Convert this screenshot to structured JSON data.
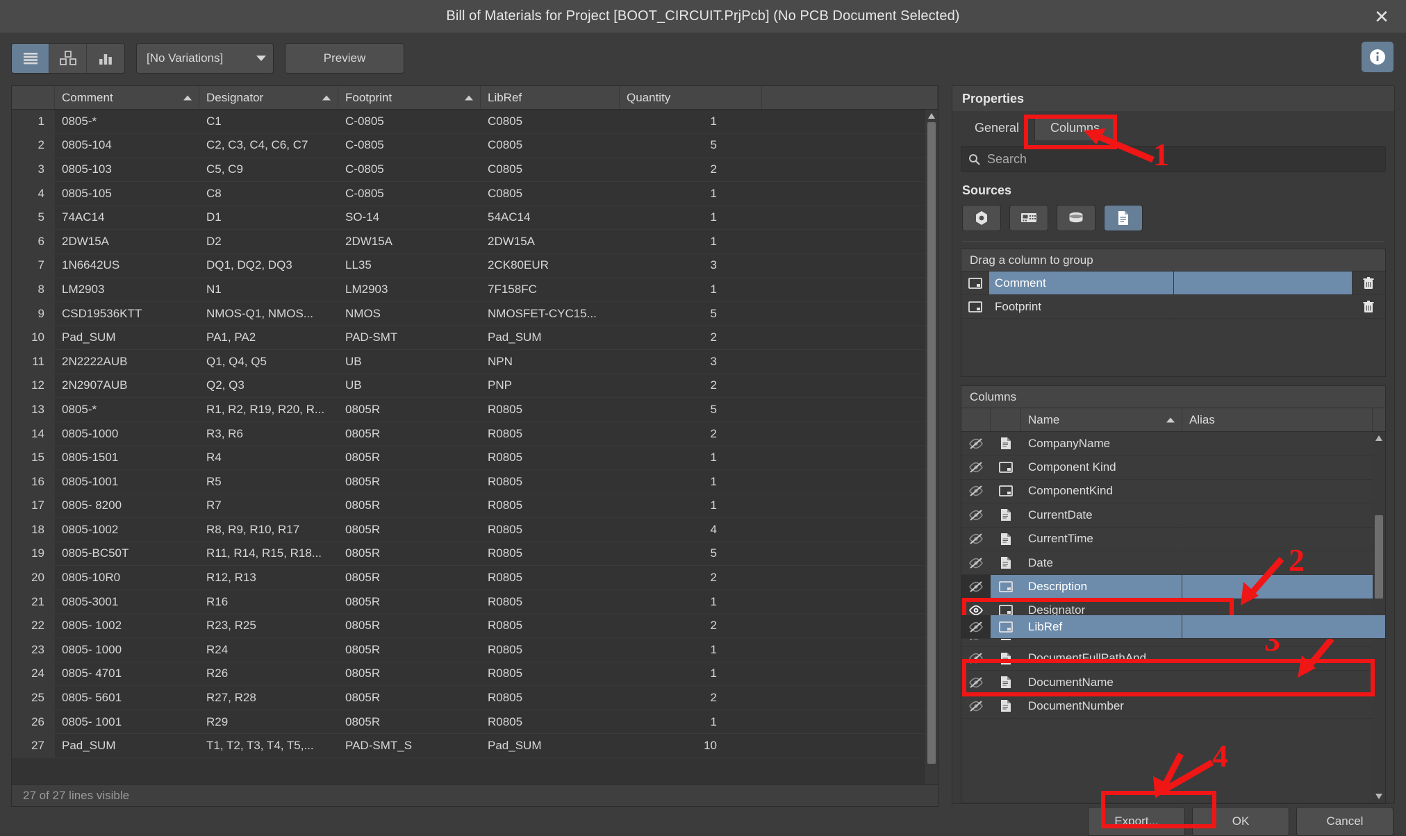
{
  "window": {
    "title": "Bill of Materials for Project [BOOT_CIRCUIT.PrjPcb] (No PCB Document Selected)",
    "close_label": "✕"
  },
  "toolbar": {
    "view_modes": [
      {
        "name": "list-view",
        "icon": "list-icon",
        "active": true
      },
      {
        "name": "grouped-view",
        "icon": "blocks-icon",
        "active": false
      },
      {
        "name": "chart-view",
        "icon": "bar-chart-icon",
        "active": false
      }
    ],
    "variation_select": {
      "value": "[No Variations]"
    },
    "preview_label": "Preview",
    "info_icon": "info-icon"
  },
  "grid": {
    "columns": [
      "Comment",
      "Designator",
      "Footprint",
      "LibRef",
      "Quantity"
    ],
    "sorted": [
      "Comment",
      "Designator",
      "Footprint"
    ],
    "rows": [
      {
        "n": "1",
        "comment": "0805-*",
        "designator": "C1",
        "footprint": "C-0805",
        "libref": "C0805",
        "qty": "1"
      },
      {
        "n": "2",
        "comment": "0805-104",
        "designator": "C2, C3, C4, C6, C7",
        "footprint": "C-0805",
        "libref": "C0805",
        "qty": "5"
      },
      {
        "n": "3",
        "comment": "0805-103",
        "designator": "C5, C9",
        "footprint": "C-0805",
        "libref": "C0805",
        "qty": "2"
      },
      {
        "n": "4",
        "comment": "0805-105",
        "designator": "C8",
        "footprint": "C-0805",
        "libref": "C0805",
        "qty": "1"
      },
      {
        "n": "5",
        "comment": "74AC14",
        "designator": "D1",
        "footprint": "SO-14",
        "libref": "54AC14",
        "qty": "1"
      },
      {
        "n": "6",
        "comment": "2DW15A",
        "designator": "D2",
        "footprint": "2DW15A",
        "libref": "2DW15A",
        "qty": "1"
      },
      {
        "n": "7",
        "comment": "1N6642US",
        "designator": "DQ1, DQ2, DQ3",
        "footprint": "LL35",
        "libref": "2CK80EUR",
        "qty": "3"
      },
      {
        "n": "8",
        "comment": "LM2903",
        "designator": "N1",
        "footprint": "LM2903",
        "libref": "7F158FC",
        "qty": "1"
      },
      {
        "n": "9",
        "comment": "CSD19536KTT",
        "designator": "NMOS-Q1, NMOS...",
        "footprint": "NMOS",
        "libref": "NMOSFET-CYC15...",
        "qty": "5"
      },
      {
        "n": "10",
        "comment": "Pad_SUM",
        "designator": "PA1, PA2",
        "footprint": "PAD-SMT",
        "libref": "Pad_SUM",
        "qty": "2"
      },
      {
        "n": "11",
        "comment": "2N2222AUB",
        "designator": "Q1, Q4, Q5",
        "footprint": "UB",
        "libref": "NPN",
        "qty": "3"
      },
      {
        "n": "12",
        "comment": "2N2907AUB",
        "designator": "Q2, Q3",
        "footprint": "UB",
        "libref": "PNP",
        "qty": "2"
      },
      {
        "n": "13",
        "comment": "0805-*",
        "designator": "R1, R2, R19, R20, R...",
        "footprint": "0805R",
        "libref": "R0805",
        "qty": "5"
      },
      {
        "n": "14",
        "comment": "0805-1000",
        "designator": "R3, R6",
        "footprint": "0805R",
        "libref": "R0805",
        "qty": "2"
      },
      {
        "n": "15",
        "comment": "0805-1501",
        "designator": "R4",
        "footprint": "0805R",
        "libref": "R0805",
        "qty": "1"
      },
      {
        "n": "16",
        "comment": "0805-1001",
        "designator": "R5",
        "footprint": "0805R",
        "libref": "R0805",
        "qty": "1"
      },
      {
        "n": "17",
        "comment": "0805- 8200",
        "designator": "R7",
        "footprint": "0805R",
        "libref": "R0805",
        "qty": "1"
      },
      {
        "n": "18",
        "comment": "0805-1002",
        "designator": "R8, R9, R10, R17",
        "footprint": "0805R",
        "libref": "R0805",
        "qty": "4"
      },
      {
        "n": "19",
        "comment": "0805-BC50T",
        "designator": "R11, R14, R15, R18...",
        "footprint": "0805R",
        "libref": "R0805",
        "qty": "5"
      },
      {
        "n": "20",
        "comment": "0805-10R0",
        "designator": "R12, R13",
        "footprint": "0805R",
        "libref": "R0805",
        "qty": "2"
      },
      {
        "n": "21",
        "comment": "0805-3001",
        "designator": "R16",
        "footprint": "0805R",
        "libref": "R0805",
        "qty": "1"
      },
      {
        "n": "22",
        "comment": "0805- 1002",
        "designator": "R23, R25",
        "footprint": "0805R",
        "libref": "R0805",
        "qty": "2"
      },
      {
        "n": "23",
        "comment": "0805- 1000",
        "designator": "R24",
        "footprint": "0805R",
        "libref": "R0805",
        "qty": "1"
      },
      {
        "n": "24",
        "comment": "0805- 4701",
        "designator": "R26",
        "footprint": "0805R",
        "libref": "R0805",
        "qty": "1"
      },
      {
        "n": "25",
        "comment": "0805- 5601",
        "designator": "R27, R28",
        "footprint": "0805R",
        "libref": "R0805",
        "qty": "2"
      },
      {
        "n": "26",
        "comment": "0805- 1001",
        "designator": "R29",
        "footprint": "0805R",
        "libref": "R0805",
        "qty": "1"
      },
      {
        "n": "27",
        "comment": "Pad_SUM",
        "designator": "T1, T2, T3, T4, T5,...",
        "footprint": "PAD-SMT_S",
        "libref": "Pad_SUM",
        "qty": "10"
      }
    ],
    "status": "27 of 27 lines visible"
  },
  "properties": {
    "title": "Properties",
    "tabs": [
      {
        "label": "General",
        "active": false
      },
      {
        "label": "Columns",
        "active": true
      }
    ],
    "search": {
      "placeholder": "Search",
      "value": "",
      "icon": "search-icon"
    },
    "sources_label": "Sources",
    "sources": [
      {
        "name": "component-source",
        "icon": "component-icon",
        "active": false
      },
      {
        "name": "pcb-source",
        "icon": "board-icon",
        "active": false
      },
      {
        "name": "database-source",
        "icon": "database-icon",
        "active": false
      },
      {
        "name": "document-source",
        "icon": "document-icon",
        "active": true
      }
    ],
    "group_box": {
      "header": "Drag a column to group",
      "rows": [
        {
          "name": "Comment",
          "selected": true,
          "kind_icon": "window-icon",
          "delete_icon": "trash-icon"
        },
        {
          "name": "Footprint",
          "selected": false,
          "kind_icon": "window-icon",
          "delete_icon": "trash-icon"
        }
      ]
    },
    "columns_box": {
      "header": "Columns",
      "col_headers": {
        "name": "Name",
        "alias": "Alias"
      },
      "rows": [
        {
          "name": "CompanyName",
          "kind": "doc",
          "visible": false,
          "selected": false
        },
        {
          "name": "Component Kind",
          "kind": "window",
          "visible": false,
          "selected": false
        },
        {
          "name": "ComponentKind",
          "kind": "window",
          "visible": false,
          "selected": false
        },
        {
          "name": "CurrentDate",
          "kind": "doc",
          "visible": false,
          "selected": false
        },
        {
          "name": "CurrentTime",
          "kind": "doc",
          "visible": false,
          "selected": false
        },
        {
          "name": "Date",
          "kind": "doc",
          "visible": false,
          "selected": false
        },
        {
          "name": "Description",
          "kind": "window",
          "visible": false,
          "selected": true
        },
        {
          "name": "Designator",
          "kind": "window",
          "visible": true,
          "selected": false
        },
        {
          "name": "Document",
          "kind": "doc",
          "visible": false,
          "selected": false
        },
        {
          "name": "DocumentFullPathAnd...",
          "kind": "doc",
          "visible": false,
          "selected": false
        },
        {
          "name": "DocumentName",
          "kind": "doc",
          "visible": false,
          "selected": false
        },
        {
          "name": "DocumentNumber",
          "kind": "doc",
          "visible": false,
          "selected": false
        }
      ],
      "dragged_row": {
        "name": "LibRef",
        "kind": "window",
        "visible": false
      }
    }
  },
  "footer": {
    "export_label": "Export...",
    "ok_label": "OK",
    "cancel_label": "Cancel"
  },
  "annotations": {
    "markers": [
      {
        "label": "1"
      },
      {
        "label": "2"
      },
      {
        "label": "3"
      },
      {
        "label": "4"
      }
    ],
    "color": "#f01616"
  }
}
